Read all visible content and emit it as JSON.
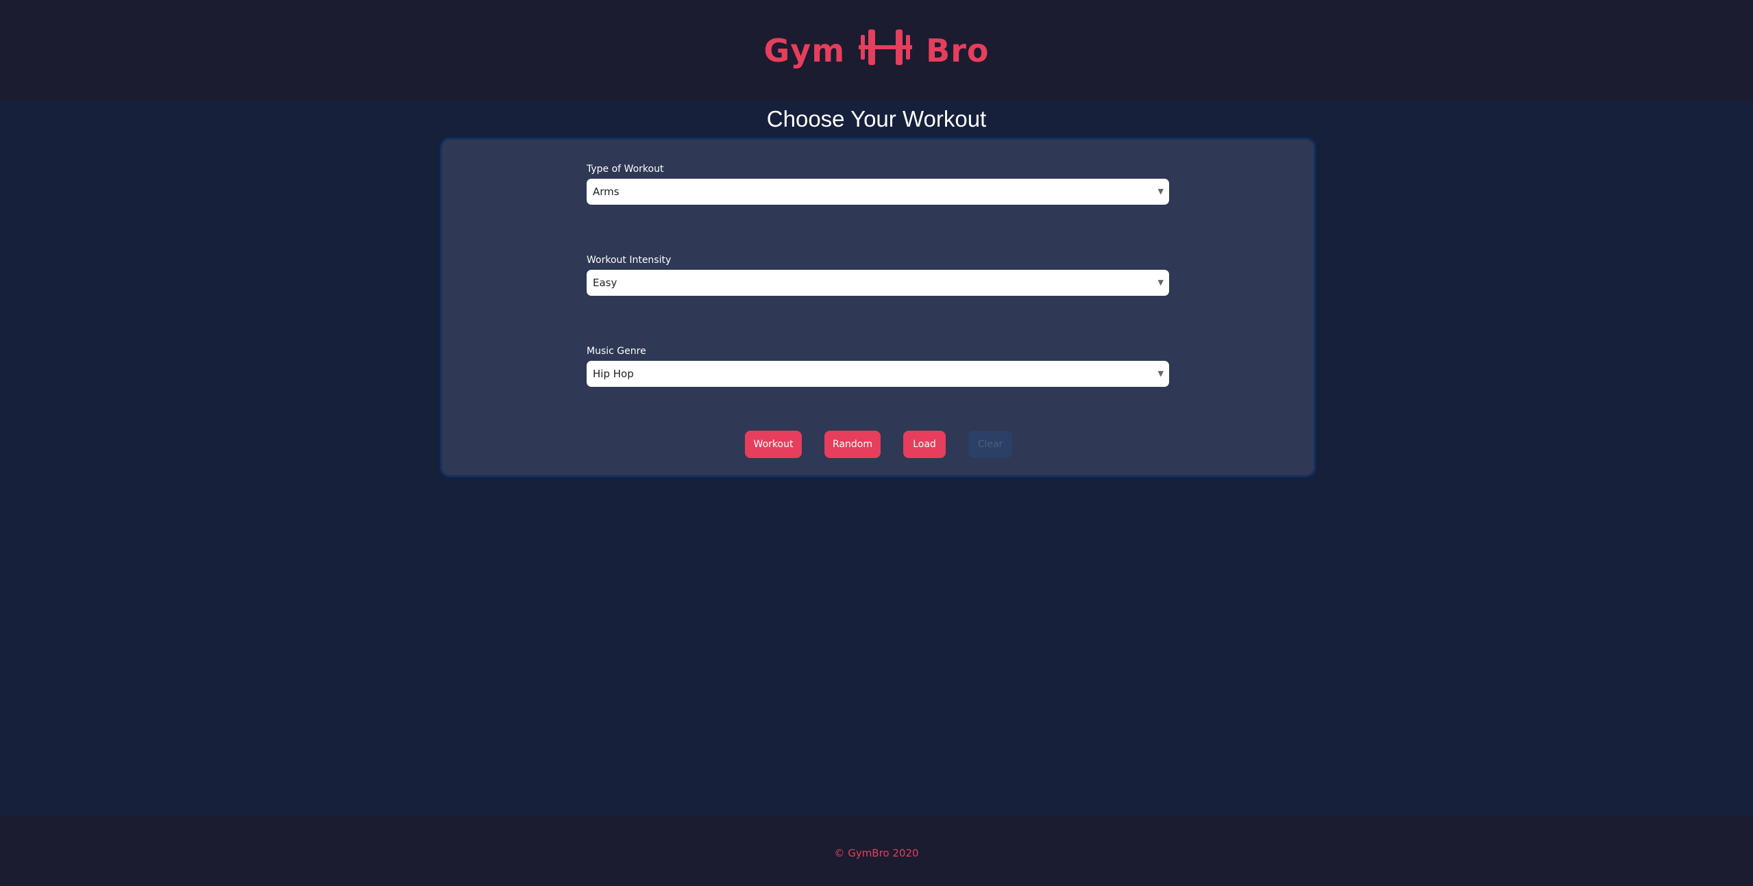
{
  "header": {
    "logo_left": "Gym",
    "logo_right": "Bro",
    "logo_icon": "dumbbell-icon"
  },
  "main": {
    "title": "Choose Your Workout"
  },
  "form": {
    "workout_type": {
      "label": "Type of Workout",
      "selected": "Arms"
    },
    "intensity": {
      "label": "Workout Intensity",
      "selected": "Easy"
    },
    "music": {
      "label": "Music Genre",
      "selected": "Hip Hop"
    },
    "caret_icon": "caret-down-icon"
  },
  "buttons": {
    "workout": "Workout",
    "random": "Random",
    "load": "Load",
    "clear": "Clear"
  },
  "footer": {
    "text": "© GymBro 2020"
  },
  "colors": {
    "accent": "#e63e5c",
    "header_bg": "#1b1c30",
    "page_bg": "#16203b",
    "panel_bg": "#2f3854",
    "disabled_button_bg": "#2a4066"
  }
}
